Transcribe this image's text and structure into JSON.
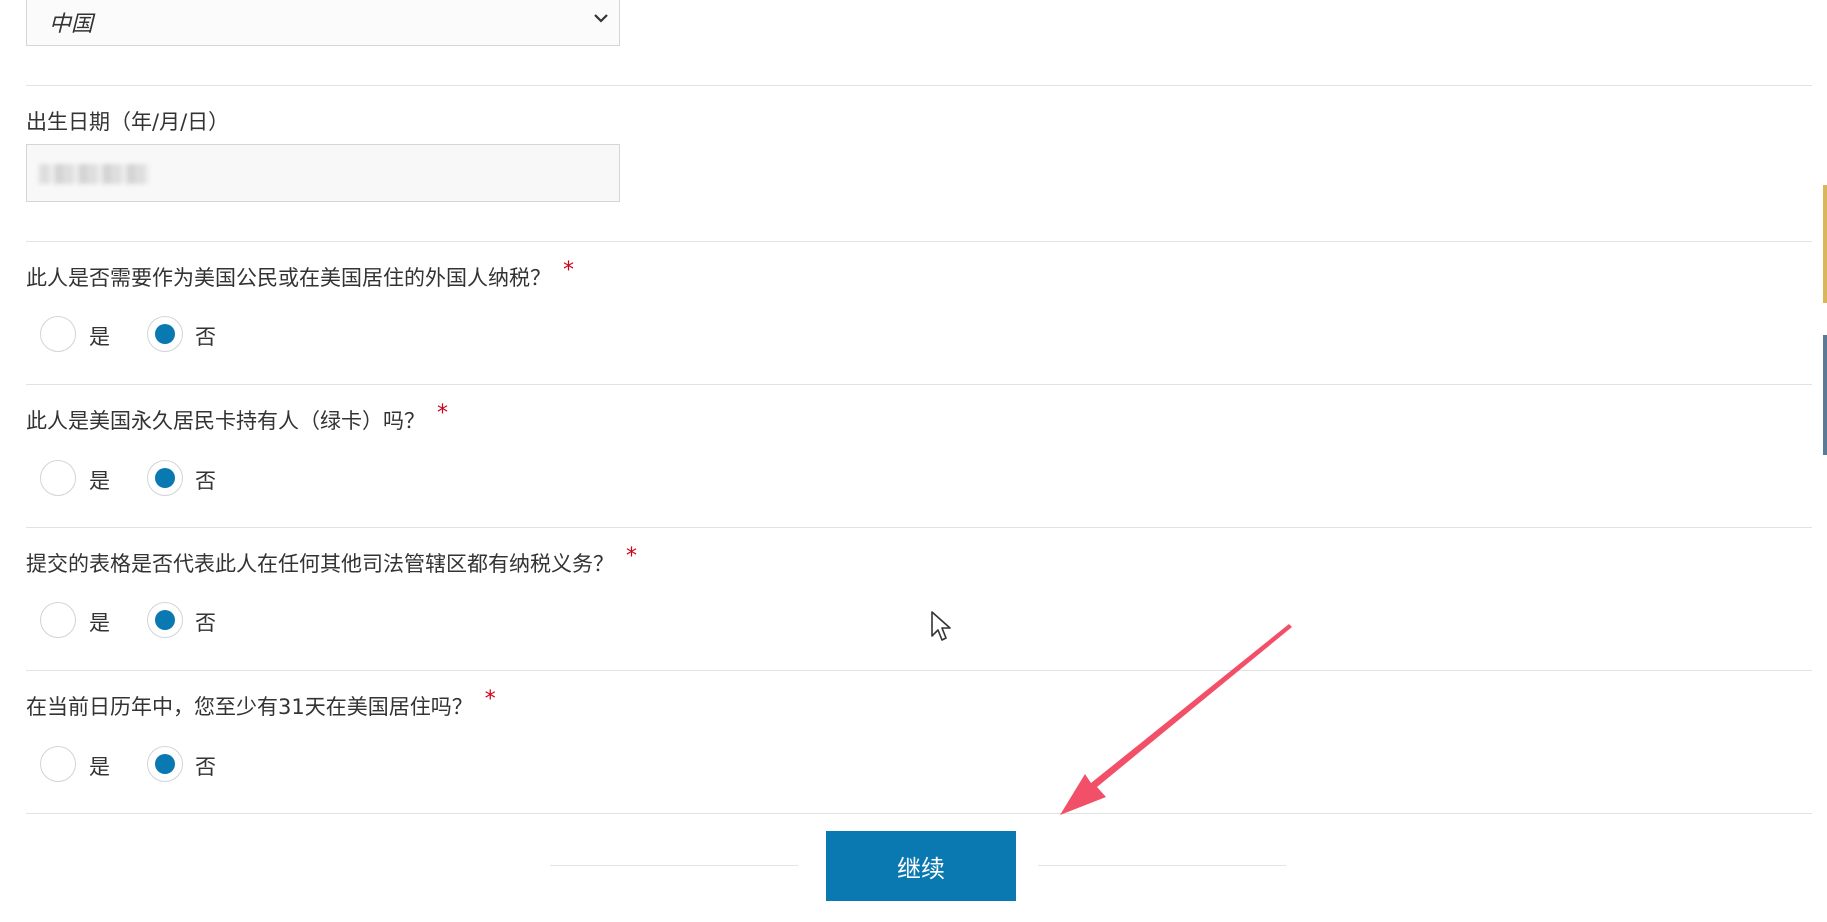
{
  "country_select": {
    "value": "中国"
  },
  "dob": {
    "label": "出生日期（年/月/日）"
  },
  "questions": [
    {
      "text": "此人是否需要作为美国公民或在美国居住的外国人纳税？",
      "required_mark": "*",
      "yes_label": "是",
      "no_label": "否",
      "selected": "否"
    },
    {
      "text": "此人是美国永久居民卡持有人（绿卡）吗？",
      "required_mark": "*",
      "yes_label": "是",
      "no_label": "否",
      "selected": "否"
    },
    {
      "text": " 提交的表格是否代表此人在任何其他司法管辖区都有纳税义务？",
      "required_mark": "*",
      "yes_label": "是",
      "no_label": "否",
      "selected": "否"
    },
    {
      "text": "在当前日历年中，您至少有31天在美国居住吗？",
      "required_mark": "*",
      "yes_label": "是",
      "no_label": "否",
      "selected": "否"
    }
  ],
  "continue_button": {
    "label": "继续"
  },
  "colors": {
    "accent": "#0a78b1",
    "required": "#d0021b",
    "annotation_arrow": "#f25068"
  },
  "icons": [
    "chevron-down-icon",
    "cursor-icon",
    "annotation-arrow"
  ]
}
